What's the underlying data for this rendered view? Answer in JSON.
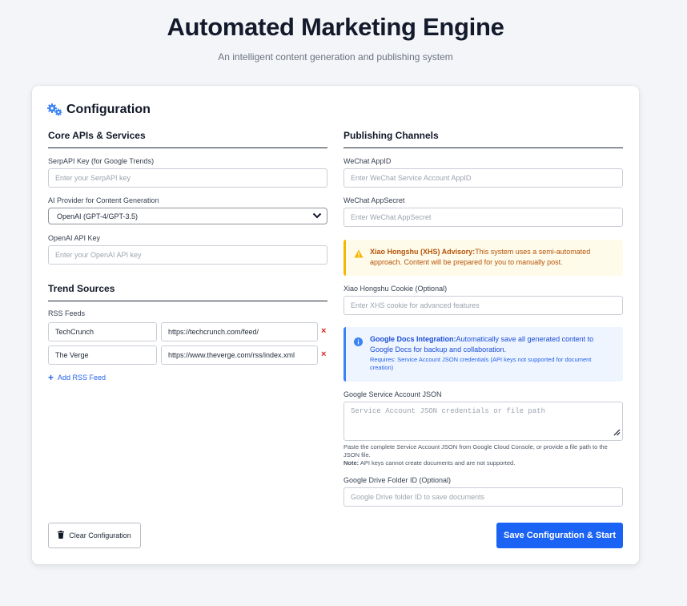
{
  "header": {
    "title": "Automated Marketing Engine",
    "subtitle": "An intelligent content generation and publishing system"
  },
  "config": {
    "title": "Configuration",
    "icon": "gears-icon"
  },
  "core": {
    "section_title": "Core APIs & Services",
    "serpapi": {
      "label": "SerpAPI Key (for Google Trends)",
      "placeholder": "Enter your SerpAPI key",
      "value": ""
    },
    "ai_provider": {
      "label": "AI Provider for Content Generation",
      "selected": "OpenAI (GPT-4/GPT-3.5)"
    },
    "openai": {
      "label": "OpenAI API Key",
      "placeholder": "Enter your OpenAI API key",
      "value": ""
    }
  },
  "trends": {
    "section_title": "Trend Sources",
    "rss_label": "RSS Feeds",
    "feeds": [
      {
        "name": "TechCrunch",
        "url": "https://techcrunch.com/feed/"
      },
      {
        "name": "The Verge",
        "url": "https://www.theverge.com/rss/index.xml"
      }
    ],
    "remove_glyph": "×",
    "add_label": "Add RSS Feed"
  },
  "publishing": {
    "section_title": "Publishing Channels",
    "wechat_appid": {
      "label": "WeChat AppID",
      "placeholder": "Enter WeChat Service Account AppID"
    },
    "wechat_secret": {
      "label": "WeChat AppSecret",
      "placeholder": "Enter WeChat AppSecret"
    },
    "xhs_advisory": {
      "title": "Xiao Hongshu (XHS) Advisory:",
      "text": "This system uses a semi-automated approach. Content will be prepared for you to manually post."
    },
    "xhs_cookie": {
      "label": "Xiao Hongshu Cookie (Optional)",
      "placeholder": "Enter XHS cookie for advanced features"
    },
    "gdocs_info": {
      "title": "Google Docs Integration:",
      "text": "Automatically save all generated content to Google Docs for backup and collaboration.",
      "sub": "Requires: Service Account JSON credentials (API keys not supported for document creation)"
    },
    "service_json": {
      "label": "Google Service Account JSON",
      "placeholder": "Service Account JSON credentials or file path",
      "help": "Paste the complete Service Account JSON from Google Cloud Console, or provide a file path to the JSON file.",
      "note_label": "Note:",
      "note": "API keys cannot create documents and are not supported."
    },
    "drive_folder": {
      "label": "Google Drive Folder ID (Optional)",
      "placeholder": "Google Drive folder ID to save documents"
    }
  },
  "actions": {
    "clear_label": "Clear Configuration",
    "save_label": "Save Configuration & Start"
  },
  "colors": {
    "primary": "#1a63f5",
    "warning_bg": "#fffbea",
    "warning_border": "#f5b700",
    "info_bg": "#eef5ff",
    "info_border": "#3b82f6",
    "danger": "#dc2626"
  }
}
